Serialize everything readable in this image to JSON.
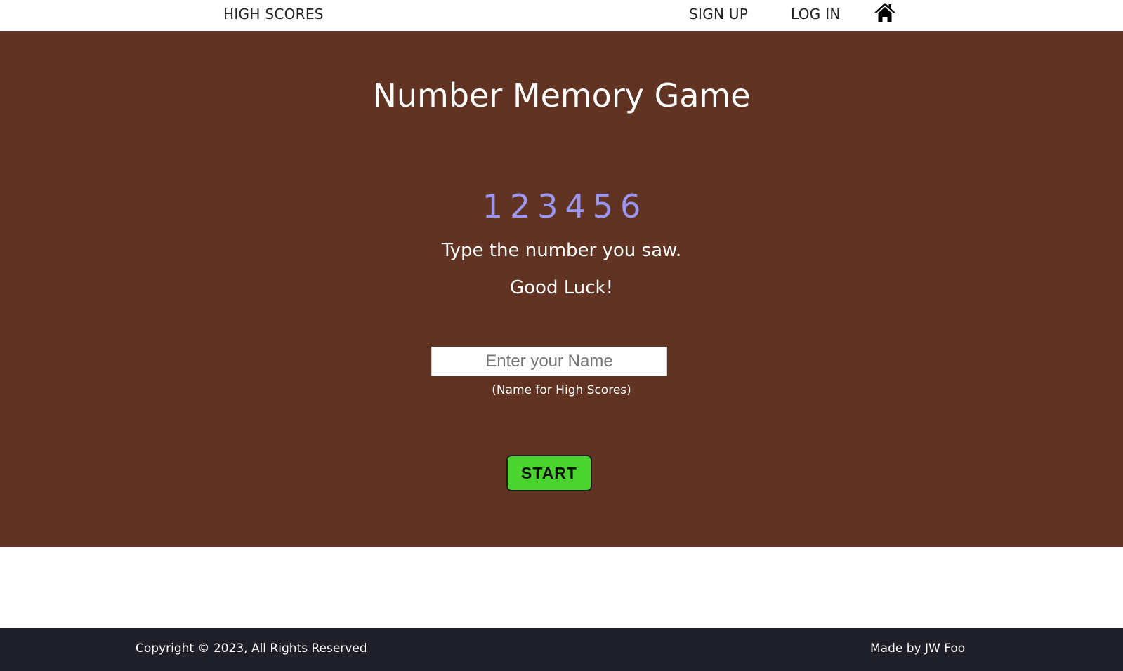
{
  "nav": {
    "high_scores": "HIGH SCORES",
    "sign_up": "SIGN UP",
    "log_in": "LOG IN",
    "home_icon": "home-icon"
  },
  "game": {
    "title": "Number Memory Game",
    "number": "123456",
    "instruction": "Type the number you saw.",
    "good_luck": "Good Luck!",
    "name_placeholder": "Enter your Name",
    "name_value": "",
    "name_hint": "(Name for High Scores)",
    "start_label": "START"
  },
  "footer": {
    "copyright": "Copyright © 2023, All Rights Reserved",
    "made_by": "Made by JW Foo"
  },
  "colors": {
    "game_background": "#603322",
    "number_color": "#9b97f0",
    "start_button": "#4bd42f",
    "footer_background": "#1f1f29",
    "nav_background": "#ffffff"
  }
}
